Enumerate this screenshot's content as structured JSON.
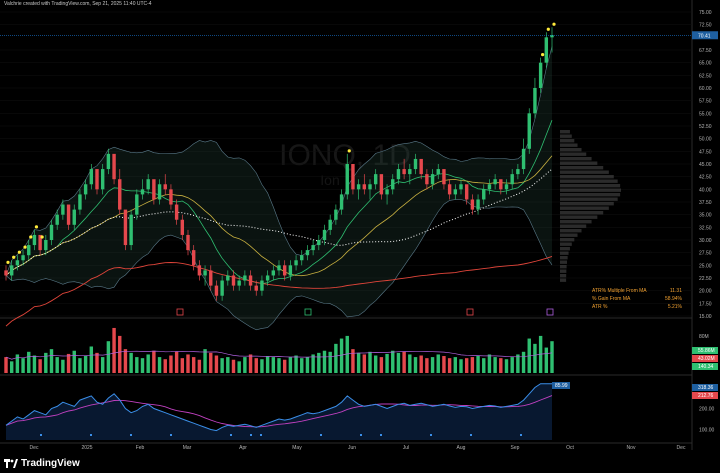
{
  "header": {
    "credit": "Valchrie created with TradingView.com, Sep 21, 2025 11:40 UTC-4"
  },
  "watermark": {
    "symbol": "IONQ, 1D",
    "subtitle": "Ion"
  },
  "brand": {
    "name": "TradingView"
  },
  "price_axis": {
    "ticks": [
      "75.00",
      "72.50",
      "70.41",
      "67.50",
      "65.00",
      "62.50",
      "60.00",
      "57.50",
      "55.00",
      "52.50",
      "50.00",
      "47.50",
      "45.00",
      "42.50",
      "40.00",
      "37.50",
      "35.00",
      "32.50",
      "30.00",
      "27.50",
      "25.00",
      "22.50",
      "20.00",
      "17.50",
      "15.00"
    ],
    "last_price": "70.41"
  },
  "volume_axis": {
    "label": "80M",
    "badges": [
      "55.86M",
      "43.02M",
      "140.34"
    ]
  },
  "indicator_axis": {
    "ticks": [
      "300.00",
      "200.00",
      "100.00"
    ],
    "badges": [
      "318.36",
      "212.76"
    ],
    "marker": "85.99"
  },
  "time_axis": {
    "labels": [
      "Dec",
      "2025",
      "Feb",
      "Mar",
      "Apr",
      "May",
      "Jun",
      "Jul",
      "Aug",
      "Sep",
      "Oct",
      "Nov",
      "Dec"
    ]
  },
  "stats": {
    "rows": [
      {
        "label": "ATR% Multiple From MA",
        "value": "11.31"
      },
      {
        "label": "% Gain From MA",
        "value": "58.94%"
      },
      {
        "label": "ATR %",
        "value": "5.21%"
      }
    ]
  },
  "colors": {
    "up": "#2fbf71",
    "down": "#e5484d",
    "background": "#000000",
    "accent_price": "#1e90ff",
    "highlight_dot": "#ffeb3b"
  },
  "chart_data": {
    "type": "candlestick",
    "ylim": [
      15,
      75
    ],
    "x_labels": [
      "Dec",
      "2025",
      "Feb",
      "Mar",
      "Apr",
      "May",
      "Jun",
      "Jul",
      "Aug",
      "Sep",
      "Oct",
      "Nov",
      "Dec"
    ],
    "candles": [
      [
        24,
        25,
        22,
        23
      ],
      [
        23,
        26,
        22,
        25
      ],
      [
        25,
        27,
        24,
        26
      ],
      [
        26,
        28,
        25,
        27
      ],
      [
        27,
        30,
        26,
        29
      ],
      [
        29,
        32,
        28,
        31
      ],
      [
        31,
        30,
        27,
        28
      ],
      [
        28,
        31,
        27,
        30
      ],
      [
        30,
        34,
        29,
        33
      ],
      [
        33,
        36,
        32,
        35
      ],
      [
        35,
        38,
        34,
        37
      ],
      [
        37,
        36,
        32,
        33
      ],
      [
        33,
        37,
        32,
        36
      ],
      [
        36,
        40,
        35,
        39
      ],
      [
        39,
        42,
        38,
        41
      ],
      [
        41,
        45,
        40,
        44
      ],
      [
        44,
        43,
        39,
        40
      ],
      [
        40,
        45,
        39,
        44
      ],
      [
        44,
        48,
        43,
        47
      ],
      [
        47,
        46,
        41,
        42
      ],
      [
        42,
        44,
        35,
        36
      ],
      [
        36,
        34,
        28,
        29
      ],
      [
        29,
        36,
        28,
        35
      ],
      [
        35,
        40,
        34,
        39
      ],
      [
        39,
        42,
        38,
        40
      ],
      [
        40,
        43,
        39,
        42
      ],
      [
        42,
        41,
        37,
        38
      ],
      [
        38,
        42,
        37,
        41
      ],
      [
        41,
        43,
        39,
        40
      ],
      [
        40,
        41,
        36,
        37
      ],
      [
        37,
        38,
        33,
        34
      ],
      [
        34,
        35,
        30,
        31
      ],
      [
        31,
        32,
        27,
        28
      ],
      [
        28,
        29,
        24,
        25
      ],
      [
        25,
        26,
        22,
        23
      ],
      [
        23,
        25,
        21,
        24
      ],
      [
        24,
        25,
        20,
        21
      ],
      [
        21,
        22,
        18,
        19
      ],
      [
        19,
        23,
        18,
        22
      ],
      [
        22,
        24,
        21,
        23
      ],
      [
        23,
        24,
        20,
        21
      ],
      [
        21,
        23,
        20,
        22
      ],
      [
        22,
        24,
        21,
        23
      ],
      [
        23,
        24,
        20,
        21
      ],
      [
        21,
        22,
        19,
        20
      ],
      [
        20,
        23,
        19,
        22
      ],
      [
        22,
        24,
        21,
        23
      ],
      [
        23,
        25,
        22,
        24
      ],
      [
        24,
        26,
        23,
        25
      ],
      [
        25,
        26,
        22,
        23
      ],
      [
        23,
        26,
        22,
        25
      ],
      [
        25,
        27,
        24,
        26
      ],
      [
        26,
        28,
        25,
        27
      ],
      [
        27,
        29,
        26,
        28
      ],
      [
        28,
        30,
        27,
        29
      ],
      [
        29,
        31,
        28,
        30
      ],
      [
        30,
        33,
        29,
        32
      ],
      [
        32,
        35,
        31,
        34
      ],
      [
        34,
        37,
        33,
        36
      ],
      [
        36,
        40,
        35,
        39
      ],
      [
        39,
        47,
        38,
        45
      ],
      [
        45,
        44,
        39,
        40
      ],
      [
        40,
        42,
        38,
        41
      ],
      [
        41,
        43,
        39,
        40
      ],
      [
        40,
        42,
        38,
        41
      ],
      [
        41,
        44,
        40,
        43
      ],
      [
        43,
        42,
        38,
        39
      ],
      [
        39,
        41,
        37,
        40
      ],
      [
        40,
        43,
        39,
        42
      ],
      [
        42,
        45,
        41,
        44
      ],
      [
        44,
        46,
        42,
        43
      ],
      [
        43,
        45,
        41,
        44
      ],
      [
        44,
        47,
        43,
        46
      ],
      [
        46,
        45,
        42,
        43
      ],
      [
        43,
        44,
        40,
        41
      ],
      [
        41,
        44,
        40,
        43
      ],
      [
        43,
        45,
        42,
        44
      ],
      [
        44,
        43,
        40,
        41
      ],
      [
        41,
        42,
        38,
        39
      ],
      [
        39,
        41,
        38,
        40
      ],
      [
        40,
        42,
        39,
        41
      ],
      [
        41,
        40,
        37,
        38
      ],
      [
        38,
        39,
        35,
        36
      ],
      [
        36,
        39,
        35,
        38
      ],
      [
        38,
        41,
        37,
        40
      ],
      [
        40,
        42,
        39,
        41
      ],
      [
        41,
        43,
        40,
        42
      ],
      [
        42,
        41,
        39,
        40
      ],
      [
        40,
        42,
        39,
        41
      ],
      [
        41,
        44,
        40,
        43
      ],
      [
        43,
        45,
        42,
        44
      ],
      [
        44,
        50,
        43,
        48
      ],
      [
        48,
        56,
        47,
        55
      ],
      [
        55,
        62,
        54,
        60
      ],
      [
        60,
        66,
        59,
        65
      ],
      [
        65,
        71,
        64,
        70
      ],
      [
        70,
        72,
        67,
        70.41
      ]
    ],
    "volumes": [
      30,
      22,
      35,
      28,
      40,
      33,
      26,
      38,
      45,
      30,
      25,
      36,
      42,
      28,
      33,
      50,
      38,
      30,
      60,
      85,
      70,
      45,
      38,
      30,
      28,
      35,
      42,
      30,
      26,
      33,
      40,
      28,
      35,
      30,
      25,
      45,
      38,
      33,
      28,
      30,
      25,
      22,
      30,
      35,
      28,
      26,
      32,
      30,
      28,
      25,
      30,
      33,
      28,
      30,
      35,
      38,
      42,
      40,
      55,
      65,
      70,
      45,
      38,
      35,
      40,
      33,
      30,
      36,
      42,
      38,
      40,
      35,
      30,
      33,
      28,
      30,
      35,
      32,
      28,
      30,
      26,
      28,
      30,
      33,
      28,
      35,
      30,
      28,
      26,
      30,
      35,
      40,
      65,
      55,
      70,
      48,
      60
    ],
    "volume_ylim": [
      0,
      100
    ],
    "indicator": [
      120,
      140,
      160,
      150,
      170,
      190,
      180,
      170,
      200,
      210,
      230,
      220,
      210,
      240,
      250,
      260,
      230,
      220,
      250,
      270,
      240,
      200,
      180,
      190,
      210,
      220,
      200,
      190,
      180,
      170,
      160,
      150,
      140,
      130,
      120,
      110,
      100,
      95,
      110,
      120,
      115,
      120,
      125,
      118,
      110,
      120,
      130,
      140,
      150,
      145,
      150,
      160,
      170,
      180,
      175,
      180,
      190,
      200,
      210,
      230,
      260,
      240,
      220,
      210,
      215,
      220,
      210,
      200,
      210,
      220,
      225,
      215,
      220,
      225,
      218,
      210,
      215,
      220,
      212,
      205,
      210,
      208,
      200,
      205,
      210,
      215,
      212,
      205,
      210,
      215,
      220,
      240,
      270,
      300,
      318,
      318,
      318
    ],
    "indicator_ylim": [
      50,
      350
    ]
  }
}
